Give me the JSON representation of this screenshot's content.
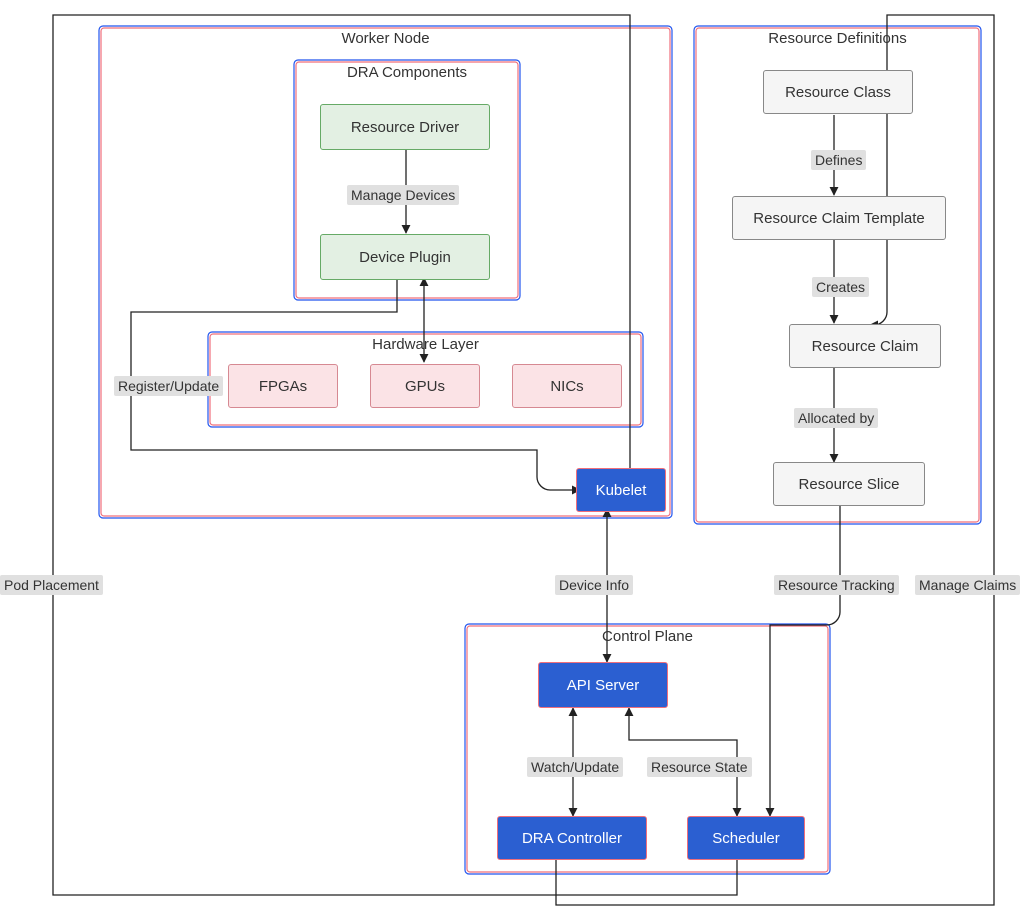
{
  "groups": {
    "worker_node": "Worker Node",
    "dra_components": "DRA Components",
    "hardware_layer": "Hardware Layer",
    "control_plane": "Control Plane",
    "resource_definitions": "Resource Definitions"
  },
  "nodes": {
    "resource_driver": "Resource Driver",
    "device_plugin": "Device Plugin",
    "fpgas": "FPGAs",
    "gpus": "GPUs",
    "nics": "NICs",
    "kubelet": "Kubelet",
    "api_server": "API Server",
    "dra_controller": "DRA Controller",
    "scheduler": "Scheduler",
    "resource_class": "Resource Class",
    "resource_claim_template": "Resource Claim Template",
    "resource_claim": "Resource Claim",
    "resource_slice": "Resource Slice"
  },
  "edges": {
    "manage_devices": "Manage Devices",
    "register_update": "Register/Update",
    "device_info": "Device Info",
    "watch_update": "Watch/Update",
    "resource_state": "Resource State",
    "pod_placement": "Pod Placement",
    "manage_claims": "Manage Claims",
    "resource_tracking": "Resource Tracking",
    "defines": "Defines",
    "creates": "Creates",
    "allocated_by": "Allocated by"
  }
}
